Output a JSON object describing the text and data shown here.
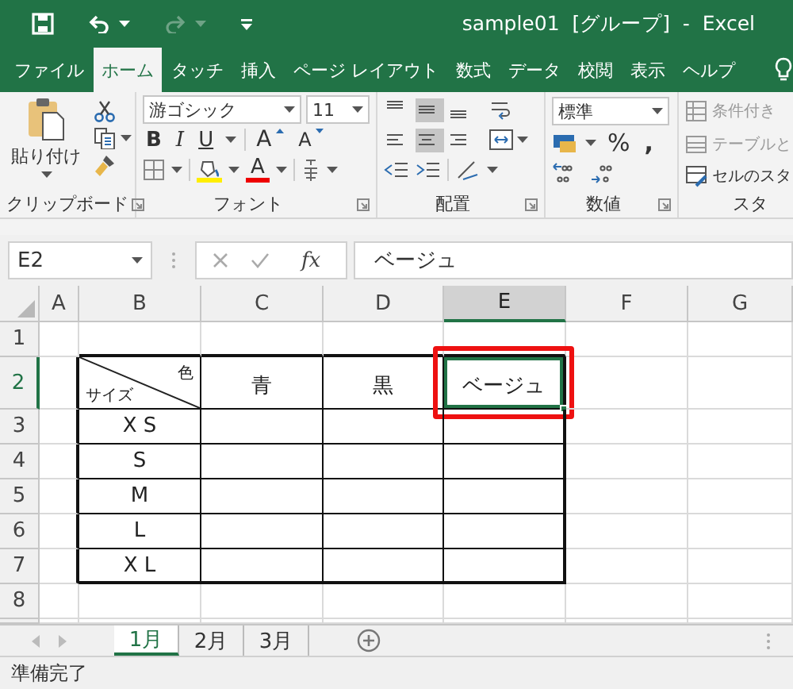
{
  "title_bar": {
    "title": "sample01  [グループ]  -  Excel"
  },
  "ribbon_tabs": [
    {
      "label": "ファイル",
      "selected": false
    },
    {
      "label": "ホーム",
      "selected": true
    },
    {
      "label": "タッチ",
      "selected": false
    },
    {
      "label": "挿入",
      "selected": false
    },
    {
      "label": "ページ レイアウト",
      "selected": false
    },
    {
      "label": "数式",
      "selected": false
    },
    {
      "label": "データ",
      "selected": false
    },
    {
      "label": "校閲",
      "selected": false
    },
    {
      "label": "表示",
      "selected": false
    },
    {
      "label": "ヘルプ",
      "selected": false
    }
  ],
  "ribbon": {
    "clipboard": {
      "paste": "貼り付け",
      "label": "クリップボード"
    },
    "font": {
      "name": "游ゴシック",
      "size": "11",
      "bold": "B",
      "italic": "I",
      "underline": "U",
      "grow": "A",
      "shrink": "A",
      "color_button": "A",
      "label": "フォント"
    },
    "alignment": {
      "vertical": [
        {
          "selected": false
        },
        {
          "selected": true
        },
        {
          "selected": false
        }
      ],
      "horizontal": [
        {
          "selected": false
        },
        {
          "selected": true
        },
        {
          "selected": false
        }
      ],
      "label": "配置"
    },
    "number": {
      "format": "標準",
      "percent": "%",
      "comma": ",",
      "label": "数値"
    },
    "styles": {
      "items": [
        {
          "label": "条件付き",
          "disabled": true
        },
        {
          "label": "テーブルと",
          "disabled": true
        },
        {
          "label": "セルのスタ",
          "disabled": false
        }
      ],
      "label": "スタ"
    }
  },
  "formula_bar": {
    "name_box": "E2",
    "fx": "fx",
    "content": "ベージュ"
  },
  "sheet": {
    "columns": [
      {
        "label": "A",
        "selected": false
      },
      {
        "label": "B",
        "selected": false
      },
      {
        "label": "C",
        "selected": false
      },
      {
        "label": "D",
        "selected": false
      },
      {
        "label": "E",
        "selected": true
      },
      {
        "label": "F",
        "selected": false
      },
      {
        "label": "G",
        "selected": false
      }
    ],
    "rows": [
      {
        "number": "1",
        "selected": false
      },
      {
        "number": "2",
        "selected": true
      },
      {
        "number": "3",
        "selected": false
      },
      {
        "number": "4",
        "selected": false
      },
      {
        "number": "5",
        "selected": false
      },
      {
        "number": "6",
        "selected": false
      },
      {
        "number": "7",
        "selected": false
      },
      {
        "number": "8",
        "selected": false
      }
    ],
    "table": {
      "corner_top": "色",
      "corner_bottom": "サイズ",
      "headers": [
        {
          "label": "青",
          "selected": false
        },
        {
          "label": "黒",
          "selected": false
        },
        {
          "label": "ベージュ",
          "selected": true
        }
      ],
      "sizes": [
        "X S",
        "S",
        "M",
        "L",
        "X L"
      ]
    }
  },
  "sheet_tabs": [
    {
      "label": "1月",
      "selected": true
    },
    {
      "label": "2月",
      "selected": false
    },
    {
      "label": "3月",
      "selected": false
    }
  ],
  "status_bar": {
    "text": "準備完了"
  }
}
